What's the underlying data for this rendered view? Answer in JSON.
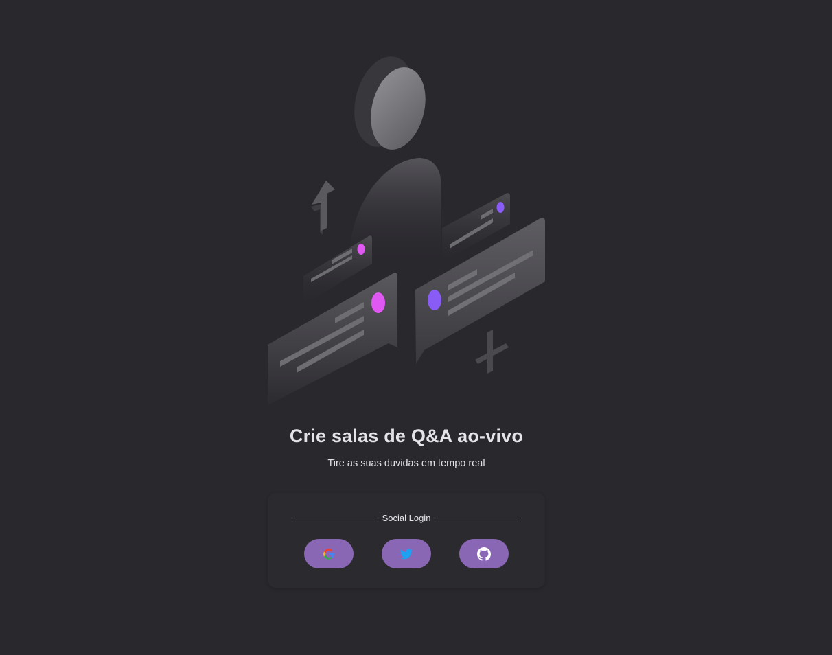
{
  "hero": {
    "title": "Crie salas de Q&A ao-vivo",
    "subtitle": "Tire as suas duvidas em tempo real"
  },
  "login": {
    "divider_label": "Social Login",
    "providers": [
      {
        "name": "Google",
        "icon": "google-icon"
      },
      {
        "name": "Twitter",
        "icon": "twitter-icon"
      },
      {
        "name": "GitHub",
        "icon": "github-icon"
      }
    ]
  },
  "colors": {
    "background": "#29282d",
    "button": "#8a67b5",
    "accent_pink": "#e058f2",
    "accent_purple": "#8a5cf6",
    "twitter_blue": "#1da1f2"
  }
}
